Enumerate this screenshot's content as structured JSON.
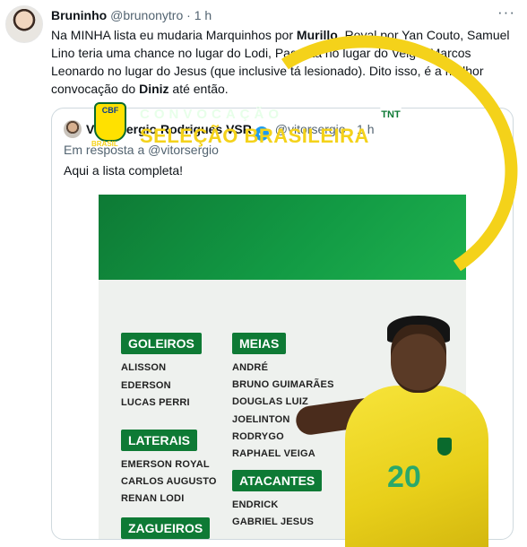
{
  "tweet": {
    "author_name": "Bruninho",
    "author_handle": "@brunonytro",
    "separator": "·",
    "time": "1 h",
    "more_icon": "more-dots-icon",
    "text_parts": {
      "p1": "Na MINHA lista eu mudaria Marquinhos por ",
      "b1": "Murillo",
      "p2": ", Royal por Yan Couto, Samuel Lino teria uma chance no lugar do Lodi, Paquetá no lugar do Veiga, Marcos Leonardo no lugar do Jesus (que inclusive tá lesionado). Dito isso, é a melhor convocação do ",
      "b2": "Diniz",
      "p3": " até então."
    }
  },
  "quoted": {
    "author_name": "Vitor Sergio Rodrigues VSR",
    "verified_icon": "verified-badge-icon",
    "author_handle": "@vitorsergio",
    "separator": "·",
    "time": "1 h",
    "reply_to": "Em resposta a @vitorsergio",
    "text": "Aqui a lista completa!"
  },
  "poster": {
    "badge_text": "CBF",
    "badge_label": "BRASIL",
    "subtitle": "CONVOCAÇÃO",
    "title": "SELEÇÃO BRASILEIRA",
    "sections": {
      "goleiros": {
        "label": "GOLEIROS",
        "players": [
          "ALISSON",
          "EDERSON",
          "LUCAS PERRI"
        ]
      },
      "laterais": {
        "label": "LATERAIS",
        "players": [
          "EMERSON ROYAL",
          "CARLOS AUGUSTO",
          "RENAN LODI"
        ]
      },
      "zagueiros": {
        "label": "ZAGUEIROS"
      },
      "meias": {
        "label": "MEIAS",
        "players": [
          "ANDRÉ",
          "BRUNO GUIMARÃES",
          "DOUGLAS LUIZ",
          "JOELINTON",
          "RODRYGO",
          "RAPHAEL VEIGA"
        ]
      },
      "atacantes": {
        "label": "ATACANTES",
        "players": [
          "ENDRICK",
          "GABRIEL JESUS"
        ]
      }
    },
    "jersey_number": "20",
    "colors": {
      "green": "#0e7a35",
      "yellow": "#f4d21a"
    }
  }
}
